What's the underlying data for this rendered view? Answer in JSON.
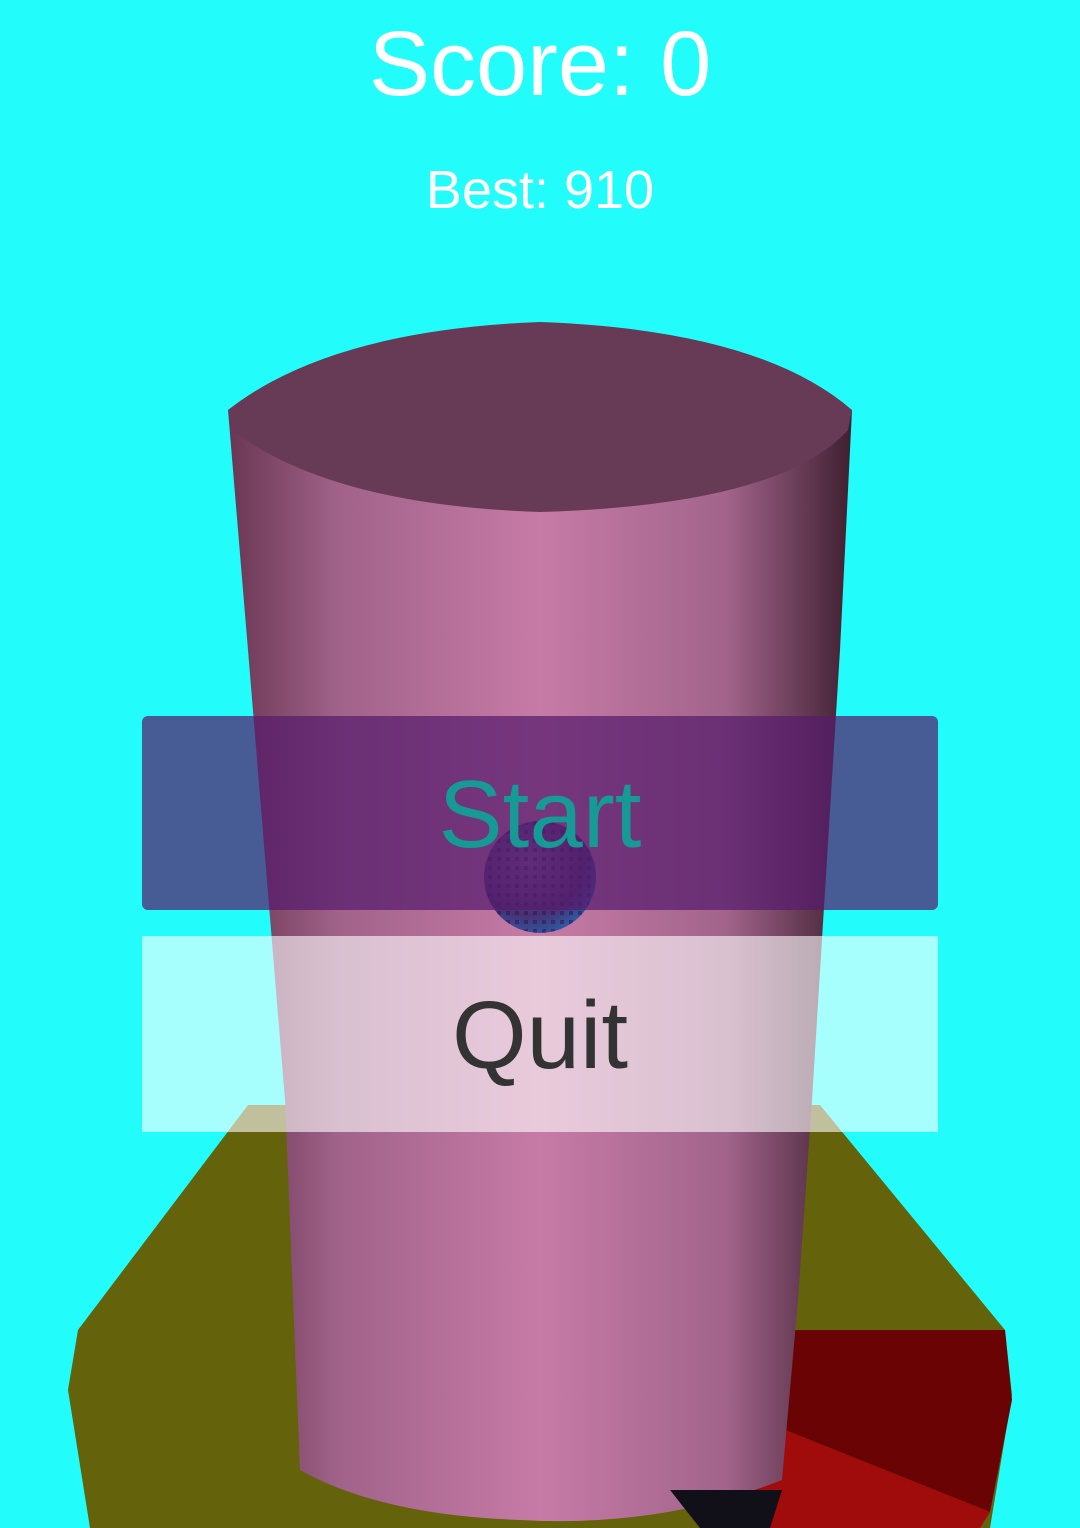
{
  "hud": {
    "score_text": "Score: 0",
    "best_text": "Best: 910"
  },
  "menu": {
    "start_label": "Start",
    "quit_label": "Quit"
  },
  "colors": {
    "sky": "#22fdfb",
    "tower": "#c57aa5",
    "tower_top": "#673a55",
    "platform": "#64620a",
    "hazard": "#a00b0b",
    "start_text": "#159a95",
    "quit_text": "#333333"
  },
  "scene": {
    "objects": [
      "tower-pillar",
      "ball",
      "platform-ring",
      "hazard-segment"
    ]
  }
}
